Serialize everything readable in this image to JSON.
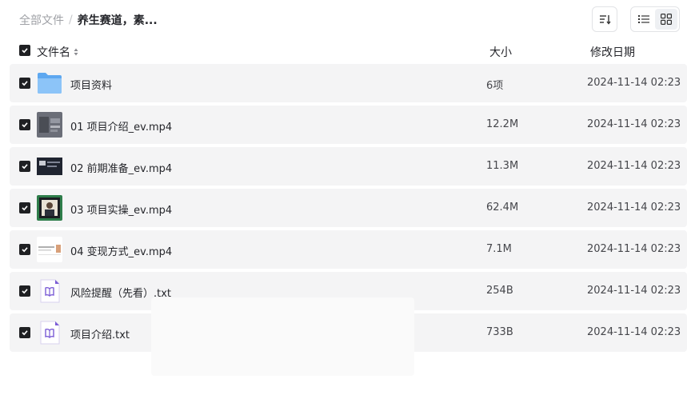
{
  "breadcrumb": {
    "root": "全部文件",
    "separator": "/",
    "current": "养生赛道，素..."
  },
  "toolbar": {
    "sort_icon": "sort-icon",
    "list_view_icon": "list-view-icon",
    "grid_view_icon": "grid-view-icon"
  },
  "table": {
    "columns": {
      "name": "文件名",
      "size": "大小",
      "date": "修改日期"
    }
  },
  "files": [
    {
      "name": "项目资料",
      "size": "6项",
      "date": "2024-11-14 02:23",
      "type": "folder",
      "checked": true
    },
    {
      "name": "01 项目介绍_ev.mp4",
      "size": "12.2M",
      "date": "2024-11-14 02:23",
      "type": "video",
      "checked": true
    },
    {
      "name": "02 前期准备_ev.mp4",
      "size": "11.3M",
      "date": "2024-11-14 02:23",
      "type": "video",
      "checked": true
    },
    {
      "name": "03 项目实操_ev.mp4",
      "size": "62.4M",
      "date": "2024-11-14 02:23",
      "type": "video",
      "checked": true
    },
    {
      "name": "04 变现方式_ev.mp4",
      "size": "7.1M",
      "date": "2024-11-14 02:23",
      "type": "video",
      "checked": true
    },
    {
      "name": "风险提醒（先看）.txt",
      "size": "254B",
      "date": "2024-11-14 02:23",
      "type": "txt",
      "checked": true
    },
    {
      "name": "项目介绍.txt",
      "size": "733B",
      "date": "2024-11-14 02:23",
      "type": "txt",
      "checked": true
    }
  ],
  "colors": {
    "row_bg": "#f4f4f5",
    "folder": "#6fb3f5",
    "txt_icon": "#7b5cd6",
    "checkbox": "#1f2023"
  }
}
